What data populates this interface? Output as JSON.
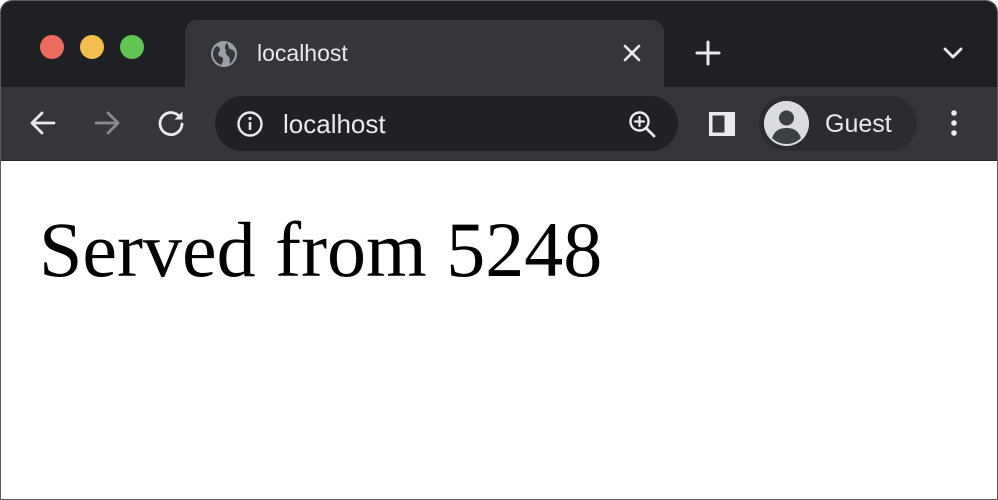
{
  "window_controls": {
    "close_color": "#ed6a5e",
    "minimize_color": "#f5bf4f",
    "maximize_color": "#61c554"
  },
  "tab": {
    "title": "localhost",
    "favicon": "globe-icon"
  },
  "toolbar": {
    "url": "localhost",
    "profile_label": "Guest",
    "icons": [
      "back-arrow-icon",
      "forward-arrow-icon",
      "reload-icon",
      "info-icon",
      "zoom-icon",
      "side-panel-icon",
      "avatar-icon",
      "more-menu-icon"
    ]
  },
  "page": {
    "heading": "Served from 5248"
  },
  "colors": {
    "tabstrip_bg": "#1f2023",
    "active_tab_bg": "#35363a",
    "omnibox_bg": "#202124",
    "text_light": "#e8eaed",
    "forward_disabled": "#8a8b8e"
  }
}
